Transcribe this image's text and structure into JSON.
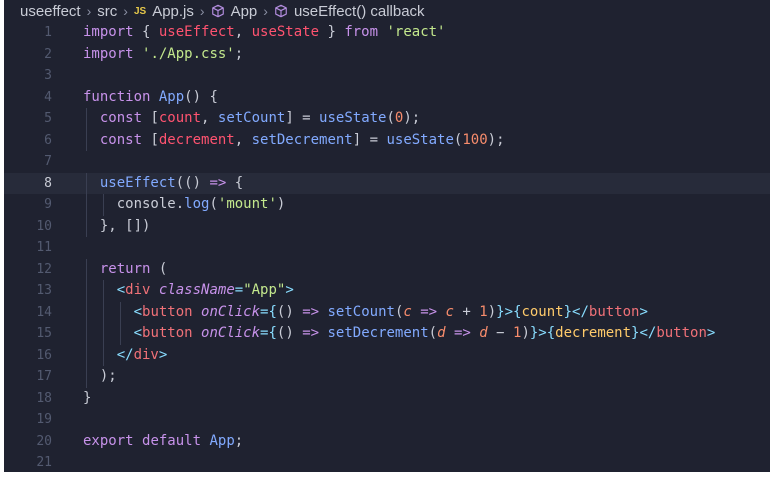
{
  "breadcrumb": {
    "folder1": "useeffect",
    "folder2": "src",
    "file_badge": "JS",
    "file": "App.js",
    "symbol1": "App",
    "symbol2": "useEffect() callback"
  },
  "code": {
    "active_line": 8,
    "lines": [
      {
        "n": "1",
        "t": [
          [
            "kw",
            "import"
          ],
          [
            "plain",
            " { "
          ],
          [
            "var",
            "useEffect"
          ],
          [
            "plain",
            ", "
          ],
          [
            "var",
            "useState"
          ],
          [
            "plain",
            " } "
          ],
          [
            "kw",
            "from"
          ],
          [
            "plain",
            " "
          ],
          [
            "str",
            "'react'"
          ]
        ]
      },
      {
        "n": "2",
        "t": [
          [
            "kw",
            "import"
          ],
          [
            "plain",
            " "
          ],
          [
            "str",
            "'./App.css'"
          ],
          [
            "plain",
            ";"
          ]
        ]
      },
      {
        "n": "3",
        "t": []
      },
      {
        "n": "4",
        "t": [
          [
            "kw",
            "function"
          ],
          [
            "plain",
            " "
          ],
          [
            "fn",
            "App"
          ],
          [
            "plain",
            "() {"
          ]
        ]
      },
      {
        "n": "5",
        "t": [
          [
            "plain",
            "  "
          ],
          [
            "kw",
            "const"
          ],
          [
            "plain",
            " ["
          ],
          [
            "var",
            "count"
          ],
          [
            "plain",
            ", "
          ],
          [
            "fn",
            "setCount"
          ],
          [
            "plain",
            "] = "
          ],
          [
            "fn",
            "useState"
          ],
          [
            "plain",
            "("
          ],
          [
            "num",
            "0"
          ],
          [
            "plain",
            ");"
          ]
        ]
      },
      {
        "n": "6",
        "t": [
          [
            "plain",
            "  "
          ],
          [
            "kw",
            "const"
          ],
          [
            "plain",
            " ["
          ],
          [
            "var",
            "decrement"
          ],
          [
            "plain",
            ", "
          ],
          [
            "fn",
            "setDecrement"
          ],
          [
            "plain",
            "] = "
          ],
          [
            "fn",
            "useState"
          ],
          [
            "plain",
            "("
          ],
          [
            "num",
            "100"
          ],
          [
            "plain",
            ");"
          ]
        ]
      },
      {
        "n": "7",
        "t": []
      },
      {
        "n": "8",
        "t": [
          [
            "plain",
            "  "
          ],
          [
            "fn",
            "useEffect"
          ],
          [
            "plain",
            "(() "
          ],
          [
            "kw",
            "=>"
          ],
          [
            "plain",
            " {"
          ]
        ]
      },
      {
        "n": "9",
        "t": [
          [
            "plain",
            "    console."
          ],
          [
            "fn",
            "log"
          ],
          [
            "plain",
            "("
          ],
          [
            "str",
            "'mount'"
          ],
          [
            "plain",
            ")"
          ]
        ]
      },
      {
        "n": "10",
        "t": [
          [
            "plain",
            "  }, [])"
          ]
        ]
      },
      {
        "n": "11",
        "t": []
      },
      {
        "n": "12",
        "t": [
          [
            "plain",
            "  "
          ],
          [
            "kw",
            "return"
          ],
          [
            "plain",
            " ("
          ]
        ]
      },
      {
        "n": "13",
        "t": [
          [
            "plain",
            "    "
          ],
          [
            "punc",
            "<"
          ],
          [
            "tag",
            "div"
          ],
          [
            "plain",
            " "
          ],
          [
            "attr",
            "className"
          ],
          [
            "punc",
            "="
          ],
          [
            "str",
            "\"App\""
          ],
          [
            "punc",
            ">"
          ]
        ]
      },
      {
        "n": "14",
        "t": [
          [
            "plain",
            "      "
          ],
          [
            "punc",
            "<"
          ],
          [
            "tag",
            "button"
          ],
          [
            "plain",
            " "
          ],
          [
            "attr",
            "onClick"
          ],
          [
            "punc",
            "={"
          ],
          [
            "plain",
            "() "
          ],
          [
            "kw",
            "=>"
          ],
          [
            "plain",
            " "
          ],
          [
            "fn",
            "setCount"
          ],
          [
            "plain",
            "("
          ],
          [
            "par",
            "c"
          ],
          [
            "plain",
            " "
          ],
          [
            "kw",
            "=>"
          ],
          [
            "plain",
            " "
          ],
          [
            "par",
            "c"
          ],
          [
            "plain",
            " + "
          ],
          [
            "num",
            "1"
          ],
          [
            "plain",
            ")"
          ],
          [
            "punc",
            "}>{"
          ],
          [
            "jsxv",
            "count"
          ],
          [
            "punc",
            "}</"
          ],
          [
            "tag",
            "button"
          ],
          [
            "punc",
            ">"
          ]
        ]
      },
      {
        "n": "15",
        "t": [
          [
            "plain",
            "      "
          ],
          [
            "punc",
            "<"
          ],
          [
            "tag",
            "button"
          ],
          [
            "plain",
            " "
          ],
          [
            "attr",
            "onClick"
          ],
          [
            "punc",
            "={"
          ],
          [
            "plain",
            "() "
          ],
          [
            "kw",
            "=>"
          ],
          [
            "plain",
            " "
          ],
          [
            "fn",
            "setDecrement"
          ],
          [
            "plain",
            "("
          ],
          [
            "par",
            "d"
          ],
          [
            "plain",
            " "
          ],
          [
            "kw",
            "=>"
          ],
          [
            "plain",
            " "
          ],
          [
            "par",
            "d"
          ],
          [
            "plain",
            " − "
          ],
          [
            "num",
            "1"
          ],
          [
            "plain",
            ")"
          ],
          [
            "punc",
            "}>{"
          ],
          [
            "jsxv",
            "decrement"
          ],
          [
            "punc",
            "}</"
          ],
          [
            "tag",
            "button"
          ],
          [
            "punc",
            ">"
          ]
        ]
      },
      {
        "n": "16",
        "t": [
          [
            "plain",
            "    "
          ],
          [
            "punc",
            "</"
          ],
          [
            "tag",
            "div"
          ],
          [
            "punc",
            ">"
          ]
        ]
      },
      {
        "n": "17",
        "t": [
          [
            "plain",
            "  );"
          ]
        ]
      },
      {
        "n": "18",
        "t": [
          [
            "plain",
            "}"
          ]
        ]
      },
      {
        "n": "19",
        "t": []
      },
      {
        "n": "20",
        "t": [
          [
            "kw",
            "export"
          ],
          [
            "plain",
            " "
          ],
          [
            "kw",
            "default"
          ],
          [
            "plain",
            " "
          ],
          [
            "fn",
            "App"
          ],
          [
            "plain",
            ";"
          ]
        ]
      },
      {
        "n": "21",
        "t": []
      }
    ]
  }
}
